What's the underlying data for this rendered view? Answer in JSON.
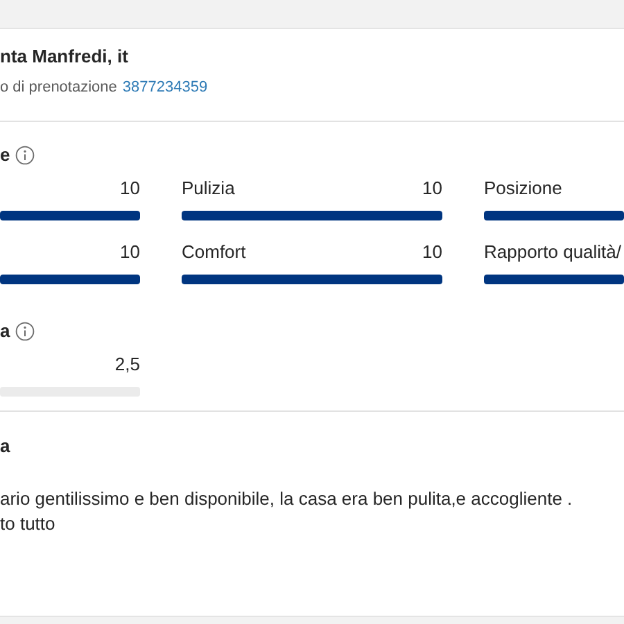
{
  "header": {
    "name": "nta Manfredi, it",
    "booking_label": "o di prenotazione",
    "booking_number": "3877234359"
  },
  "scores": {
    "heading": "e",
    "items": [
      {
        "value": "10",
        "level": 1
      },
      {
        "label": "Pulizia",
        "value": "10",
        "level": 1
      },
      {
        "label": "Posizione",
        "level": 1
      },
      {
        "value": "10",
        "level": 1
      },
      {
        "label": "Comfort",
        "value": "10",
        "level": 1
      },
      {
        "label": "Rapporto qualità/",
        "level": 1
      }
    ]
  },
  "extra": {
    "heading": "a",
    "value": "2,5"
  },
  "review": {
    "heading": "a",
    "text": "ario gentilissimo e ben disponibile, la casa era ben pulita,e accogliente .\nto tutto"
  }
}
